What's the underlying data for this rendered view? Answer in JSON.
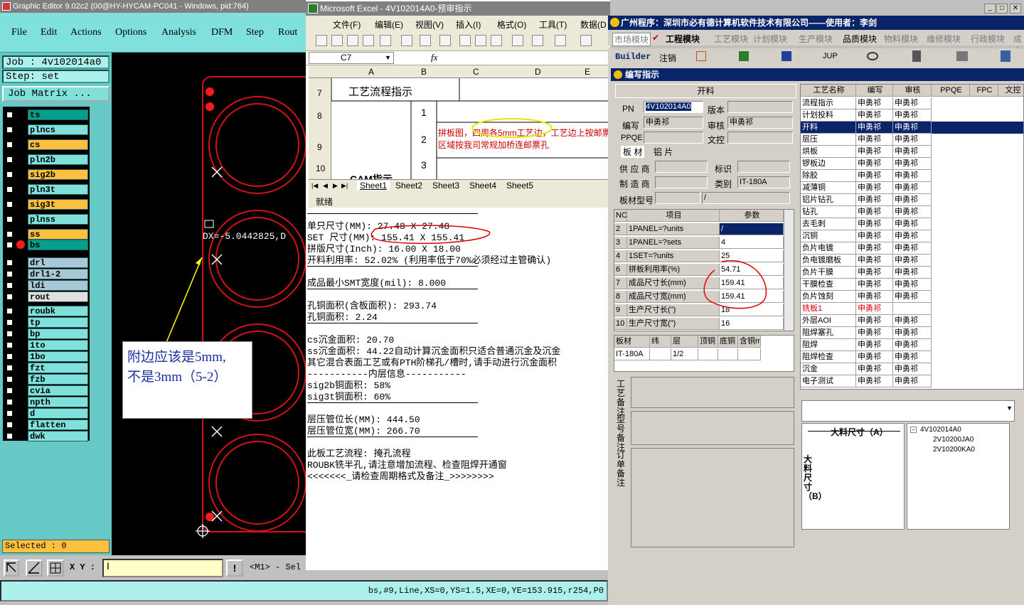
{
  "ge": {
    "title": "Graphic Editor 9.02c2 (00@HY-HYCAM-PC041 - Windows, pid:764)",
    "menu": [
      "File",
      "Edit",
      "Actions",
      "Options",
      "Analysis",
      "DFM",
      "Step",
      "Rout"
    ],
    "job": "Job : 4v102014a0",
    "step": "Step: set",
    "job_matrix": "Job Matrix ...",
    "layers": [
      {
        "name": "ts",
        "color": "#00a08c"
      },
      {
        "name": "plncs",
        "color": "#7fe0dc"
      },
      {
        "name": "cs",
        "color": "#ffc040"
      },
      {
        "name": "pln2b",
        "color": "#7fe0dc"
      },
      {
        "name": "sig2b",
        "color": "#ffc040"
      },
      {
        "name": "pln3t",
        "color": "#7fe0dc"
      },
      {
        "name": "sig3t",
        "color": "#ffc040"
      },
      {
        "name": "plnss",
        "color": "#7fe0dc"
      },
      {
        "name": "ss",
        "color": "#ffc040"
      },
      {
        "name": "bs",
        "color": "#00a08c"
      },
      {
        "name": "drl",
        "color": "#a8c8d8"
      },
      {
        "name": "drl1-2",
        "color": "#a8c8d8"
      },
      {
        "name": "ldi",
        "color": "#a8c8d8"
      },
      {
        "name": "rout",
        "color": "#e0e0e0"
      },
      {
        "name": "roubk",
        "color": "#7fe0dc"
      },
      {
        "name": "tp",
        "color": "#7fe0dc"
      },
      {
        "name": "bp",
        "color": "#7fe0dc"
      },
      {
        "name": "1to",
        "color": "#7fe0dc"
      },
      {
        "name": "1bo",
        "color": "#7fe0dc"
      },
      {
        "name": "fzt",
        "color": "#7fe0dc"
      },
      {
        "name": "fzb",
        "color": "#7fe0dc"
      },
      {
        "name": "cvia",
        "color": "#7fe0dc"
      },
      {
        "name": "npth",
        "color": "#7fe0dc"
      },
      {
        "name": "d",
        "color": "#7fe0dc"
      },
      {
        "name": "flatten",
        "color": "#7fe0dc"
      },
      {
        "name": "dwk",
        "color": "#7fe0dc"
      }
    ],
    "selected": "Selected : 0",
    "xy_label": "X Y :",
    "xy_value": "I",
    "mode_text": "<M1> - Sel",
    "status": "bs,#9,Line,XS=0,YS=1.5,XE=0,YE=153.915,r254,P0",
    "measure": "DX=-5.0442825,D",
    "annotation_line1": "附边应该是5mm,",
    "annotation_line2": "不是3mm（5-2）"
  },
  "xl": {
    "title": "Microsoft Excel - 4V102014A0-预审指示",
    "menu": [
      "文件(F)",
      "编辑(E)",
      "视图(V)",
      "插入(I)",
      "格式(O)",
      "工具(T)",
      "数据(D"
    ],
    "namebox": "C7",
    "fx": "fx",
    "cols": [
      "A",
      "B",
      "C",
      "D",
      "E"
    ],
    "rows": [
      "7",
      "8",
      "9",
      "10"
    ],
    "a7": "工艺流程指示",
    "a10": "CAM指示",
    "b8": "1",
    "b9": "2",
    "b10": "3",
    "c9_line1": "拼板图，四周各5mm工艺边，工艺边上按邮票孔",
    "c9_line2": "区域按我司常规加桥连邮票孔",
    "sheets": [
      "Sheet1",
      "Sheet2",
      "Sheet3",
      "Sheet4",
      "Sheet5"
    ],
    "ready": "就绪",
    "lines": [
      "单只尺寸(MM): 27.48 X 27.48",
      "SET 尺寸(MM): 155.41 X 155.41",
      "拼版尺寸(Inch): 16.00 X 18.00",
      "开料利用率: 52.02% (利用率低于70%必须经过主管确认)",
      "成品最小SMT宽度(mil): 8.000",
      "孔铜面积(含板面积): 293.74",
      "孔铜面积: 2.24",
      "cs沉金面积: 20.70",
      "ss沉金面积: 44.22自动计算沉金面积只适合普通沉金及沉金",
      "其它混合表面工艺或有PTH阶梯孔/槽时,请手动进行沉金面积",
      "-----------内层信息-----------",
      "sig2b铜面积: 58%",
      "sig3t铜面积: 60%",
      "层压管位长(MM): 444.50",
      "层压管位宽(MM): 266.70",
      "此板工艺流程: 掩孔流程",
      "ROUBK铣半孔,请注意增加流程、检查阻焊开通窗",
      "<<<<<<<_请检查周期格式及备注_>>>>>>>>"
    ]
  },
  "ra": {
    "title": "广州程序：深圳市必有德计算机软件技术有限公司——使用者：李剑",
    "modules": [
      "市场模块",
      "工程模块",
      "工艺模块",
      "计划模块",
      "生产模块",
      "品质模块",
      "物料模块",
      "维修模块",
      "行政模块",
      "成本"
    ],
    "toolbar": [
      "Builder",
      "注销",
      "JUP"
    ],
    "dialog_title": "编写指示",
    "section": "开料",
    "pn_label": "PN",
    "pn": "4V102014A0",
    "version_label": "版本",
    "author_label": "编写",
    "author": "申勇祁",
    "review_label": "审核",
    "reviewer": "申勇祁",
    "ppqe_label": "PPQE",
    "doc_label": "文控",
    "tab_board": "板 材",
    "tab_foil": "铝 片",
    "supplier_label": "供 应 商",
    "mark_label": "标识",
    "maker_label": "制 造 商",
    "type_label": "类别",
    "type": "IT-180A",
    "model_label": "板材型号",
    "model_sep": "/",
    "param_headers": [
      "NO",
      "项目",
      "参数"
    ],
    "params": [
      {
        "no": "2",
        "item": "1PANEL=?units",
        "val": "/"
      },
      {
        "no": "3",
        "item": "1PANEL=?sets",
        "val": "4"
      },
      {
        "no": "4",
        "item": "1SET=?units",
        "val": "25"
      },
      {
        "no": "6",
        "item": "拼板利用率(%)",
        "val": "54.71"
      },
      {
        "no": "7",
        "item": "成品尺寸长(mm)",
        "val": "159.41"
      },
      {
        "no": "8",
        "item": "成品尺寸宽(mm)",
        "val": "159.41"
      },
      {
        "no": "9",
        "item": "生产尺寸长(\")",
        "val": "18"
      },
      {
        "no": "10",
        "item": "生产尺寸宽(\")",
        "val": "16"
      }
    ],
    "board_headers": [
      "板材",
      "纬",
      "层",
      "顶铜",
      "底铜",
      "含铜mm"
    ],
    "board_row": [
      "IT-180A",
      "",
      "1/2",
      "",
      "",
      ""
    ],
    "note_labels": [
      "工艺备注",
      "型号备注",
      "订单备注"
    ],
    "proc_headers": [
      "工艺名称",
      "编写",
      "审核",
      "PPQE",
      "FPC",
      "文控"
    ],
    "processes": [
      {
        "name": "流程指示",
        "w": "申勇祁",
        "r": "申勇祁"
      },
      {
        "name": "计划投料",
        "w": "申勇祁",
        "r": "申勇祁"
      },
      {
        "name": "开料",
        "w": "申勇祁",
        "r": "申勇祁"
      },
      {
        "name": "层压",
        "w": "申勇祁",
        "r": "申勇祁"
      },
      {
        "name": "烘板",
        "w": "申勇祁",
        "r": "申勇祁"
      },
      {
        "name": "锣板边",
        "w": "申勇祁",
        "r": "申勇祁"
      },
      {
        "name": "除胶",
        "w": "申勇祁",
        "r": "申勇祁"
      },
      {
        "name": "减薄铜",
        "w": "申勇祁",
        "r": "申勇祁"
      },
      {
        "name": "铝片钻孔",
        "w": "申勇祁",
        "r": "申勇祁"
      },
      {
        "name": "钻孔",
        "w": "申勇祁",
        "r": "申勇祁"
      },
      {
        "name": "去毛刺",
        "w": "申勇祁",
        "r": "申勇祁"
      },
      {
        "name": "沉铜",
        "w": "申勇祁",
        "r": "申勇祁"
      },
      {
        "name": "负片电镀",
        "w": "申勇祁",
        "r": "申勇祁"
      },
      {
        "name": "负电镀磨板",
        "w": "申勇祁",
        "r": "申勇祁"
      },
      {
        "name": "负片干膜",
        "w": "申勇祁",
        "r": "申勇祁"
      },
      {
        "name": "干膜检查",
        "w": "申勇祁",
        "r": "申勇祁"
      },
      {
        "name": "负片蚀刻",
        "w": "申勇祁",
        "r": "申勇祁"
      },
      {
        "name": "铣板1",
        "w": "申勇祁",
        "r": ""
      },
      {
        "name": "外层AOI",
        "w": "申勇祁",
        "r": "申勇祁"
      },
      {
        "name": "阻焊塞孔",
        "w": "申勇祁",
        "r": "申勇祁"
      },
      {
        "name": "阻焊",
        "w": "申勇祁",
        "r": "申勇祁"
      },
      {
        "name": "阻焊检查",
        "w": "申勇祁",
        "r": "申勇祁"
      },
      {
        "name": "沉金",
        "w": "申勇祁",
        "r": "申勇祁"
      },
      {
        "name": "电子测试",
        "w": "申勇祁",
        "r": "申勇祁"
      }
    ],
    "dim_a": "大料尺寸（A）",
    "dim_b": "大料尺寸（B）",
    "tree_root": "4V102014A0",
    "tree_children": [
      "2V10200JA0",
      "2V10200KA0"
    ]
  }
}
